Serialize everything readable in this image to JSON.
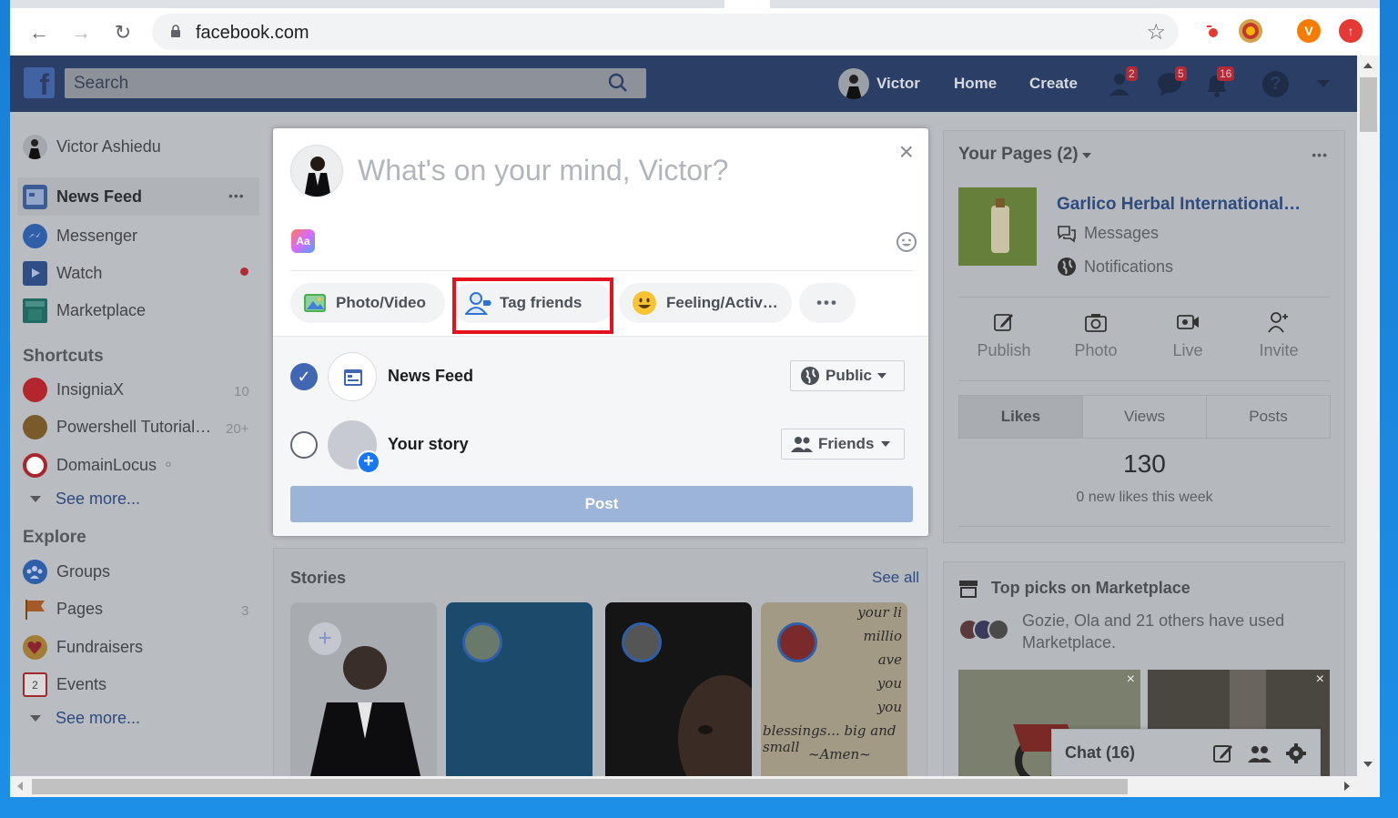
{
  "browser": {
    "url": "facebook.com",
    "profile_initial": "V"
  },
  "topbar": {
    "search_placeholder": "Search",
    "user_name": "Victor",
    "home": "Home",
    "create": "Create",
    "friend_requests_count": "2",
    "messages_count": "5",
    "notifications_count": "16",
    "help": "?"
  },
  "left_nav": {
    "user_full_name": "Victor Ashiedu",
    "main_items": [
      {
        "label": "News Feed"
      },
      {
        "label": "Messenger"
      },
      {
        "label": "Watch"
      },
      {
        "label": "Marketplace"
      }
    ],
    "more_dots": "•••",
    "shortcuts_heading": "Shortcuts",
    "shortcuts": [
      {
        "label": "InsigniaX",
        "count": "10"
      },
      {
        "label": "Powershell Tutorial…",
        "count": "20+"
      },
      {
        "label": "DomainLocus",
        "count": ""
      }
    ],
    "see_more_1": "See more...",
    "explore_heading": "Explore",
    "explore": [
      {
        "label": "Groups",
        "count": ""
      },
      {
        "label": "Pages",
        "count": "3"
      },
      {
        "label": "Fundraisers",
        "count": ""
      },
      {
        "label": "Events",
        "count": ""
      }
    ],
    "see_more_2": "See more...",
    "events_icon_day": "2"
  },
  "composer": {
    "prompt": "What's on your mind, Victor?",
    "text_style_icon_label": "Aa",
    "actions": [
      {
        "label": "Photo/Video"
      },
      {
        "label": "Tag friends"
      },
      {
        "label": "Feeling/Activ…"
      }
    ],
    "more_dots": "•••",
    "share_options": [
      {
        "label": "News Feed",
        "audience": "Public",
        "checked": true
      },
      {
        "label": "Your story",
        "audience": "Friends",
        "checked": false
      }
    ],
    "post_button": "Post",
    "highlighted_action": "Tag friends",
    "highlight_color": "#e3121c"
  },
  "stories": {
    "title": "Stories",
    "see_all": "See all",
    "story_text_lines": [
      "your li",
      "millio",
      "ave",
      "you",
      "you",
      "blessings... big and small",
      "~Amen~"
    ]
  },
  "right_panel": {
    "your_pages_title": "Your Pages (2)",
    "more_dots": "•••",
    "page_name": "Garlico Herbal International…",
    "messages": "Messages",
    "notifications": "Notifications",
    "actions": [
      "Publish",
      "Photo",
      "Live",
      "Invite"
    ],
    "tabs": [
      "Likes",
      "Views",
      "Posts"
    ],
    "likes_count": "130",
    "likes_subtitle": "0 new likes this week",
    "marketplace_title": "Top picks on Marketplace",
    "marketplace_text": "Gozie, Ola and 21 others have used Marketplace.",
    "chat_label": "Chat (16)"
  },
  "colors": {
    "fb_blue": "#4267b2",
    "accent_red": "#e3121c",
    "post_button": "#9cb4d8"
  }
}
